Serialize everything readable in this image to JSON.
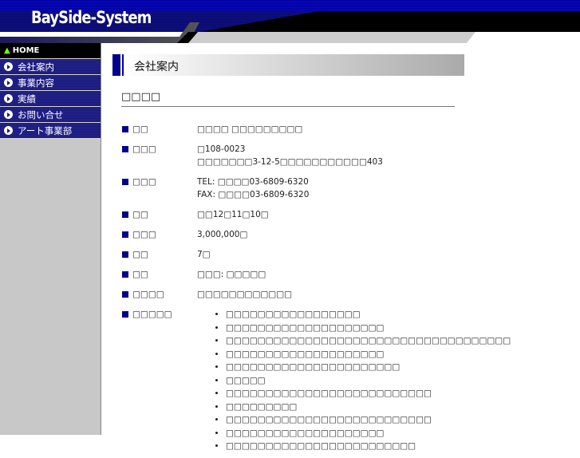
{
  "header": {
    "logo": "BaySide-System"
  },
  "nav": [
    {
      "label": "HOME"
    },
    {
      "label": "会社案内"
    },
    {
      "label": "事業内容"
    },
    {
      "label": "実績"
    },
    {
      "label": "お問い合せ"
    },
    {
      "label": "アート事業部"
    }
  ],
  "page_title": "会社案内",
  "section_title": "□□□□",
  "rows": [
    {
      "label": "□□",
      "lines": [
        "□□□□ □□□□□□□□□"
      ]
    },
    {
      "label": "□□□",
      "lines": [
        "□108-0023",
        "□□□□□□□3-12-5□□□□□□□□□□□403"
      ]
    },
    {
      "label": "□□□",
      "lines": [
        "TEL: □□□□03-6809-6320",
        "FAX: □□□□03-6809-6320"
      ]
    },
    {
      "label": "□□",
      "lines": [
        "□□12□11□10□"
      ]
    },
    {
      "label": "□□□",
      "lines": [
        "3,000,000□"
      ]
    },
    {
      "label": "□□",
      "lines": [
        "7□"
      ]
    },
    {
      "label": "□□",
      "lines": [
        "□□□: □□□□□"
      ]
    },
    {
      "label": "□□□□",
      "lines": [
        "□□□□□□□□□□□□"
      ]
    },
    {
      "label": "□□□□□",
      "lines": []
    }
  ],
  "business": [
    "□□□□□□□□□□□□□□□□□",
    "□□□□□□□□□□□□□□□□□□□□",
    "□□□□□□□□□□□□□□□□□□□□□□□□□□□□□□□□□□□□",
    "□□□□□□□□□□□□□□□□□□□□",
    "□□□□□□□□□□□□□□□□□□□□□□",
    "□□□□□",
    "□□□□□□□□□□□□□□□□□□□□□□□□□□",
    "□□□□□□□□□",
    "□□□□□□□□□□□□□□□□□□□□□□□□□□",
    "□□□□□□□□□□□□□□□□□□□□",
    "□□□□□□□□□□□□□□□□□□□□□□□□"
  ]
}
